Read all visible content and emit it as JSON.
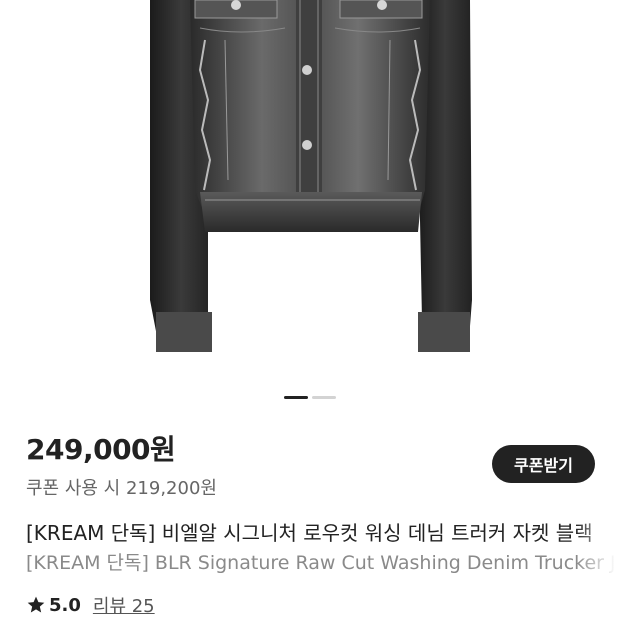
{
  "product": {
    "image_alt": "Denim trucker jacket",
    "carousel": {
      "current": 1,
      "total": 2
    },
    "price": "249,000원",
    "coupon_price": "쿠폰 사용 시 219,200원",
    "coupon_button": "쿠폰받기",
    "title_ko": "[KREAM 단독] 비엘알 시그니처 로우컷 워싱 데님 트러커 자켓 블랙",
    "title_en": "[KREAM 단독] BLR Signature Raw Cut Washing Denim Trucker Jacket Black",
    "rating": "5.0",
    "review_label": "리뷰 25",
    "star_icon": "star-icon"
  },
  "colors": {
    "button_bg": "#222222",
    "accent_text": "#222222",
    "muted_text": "#8a8a8a"
  }
}
